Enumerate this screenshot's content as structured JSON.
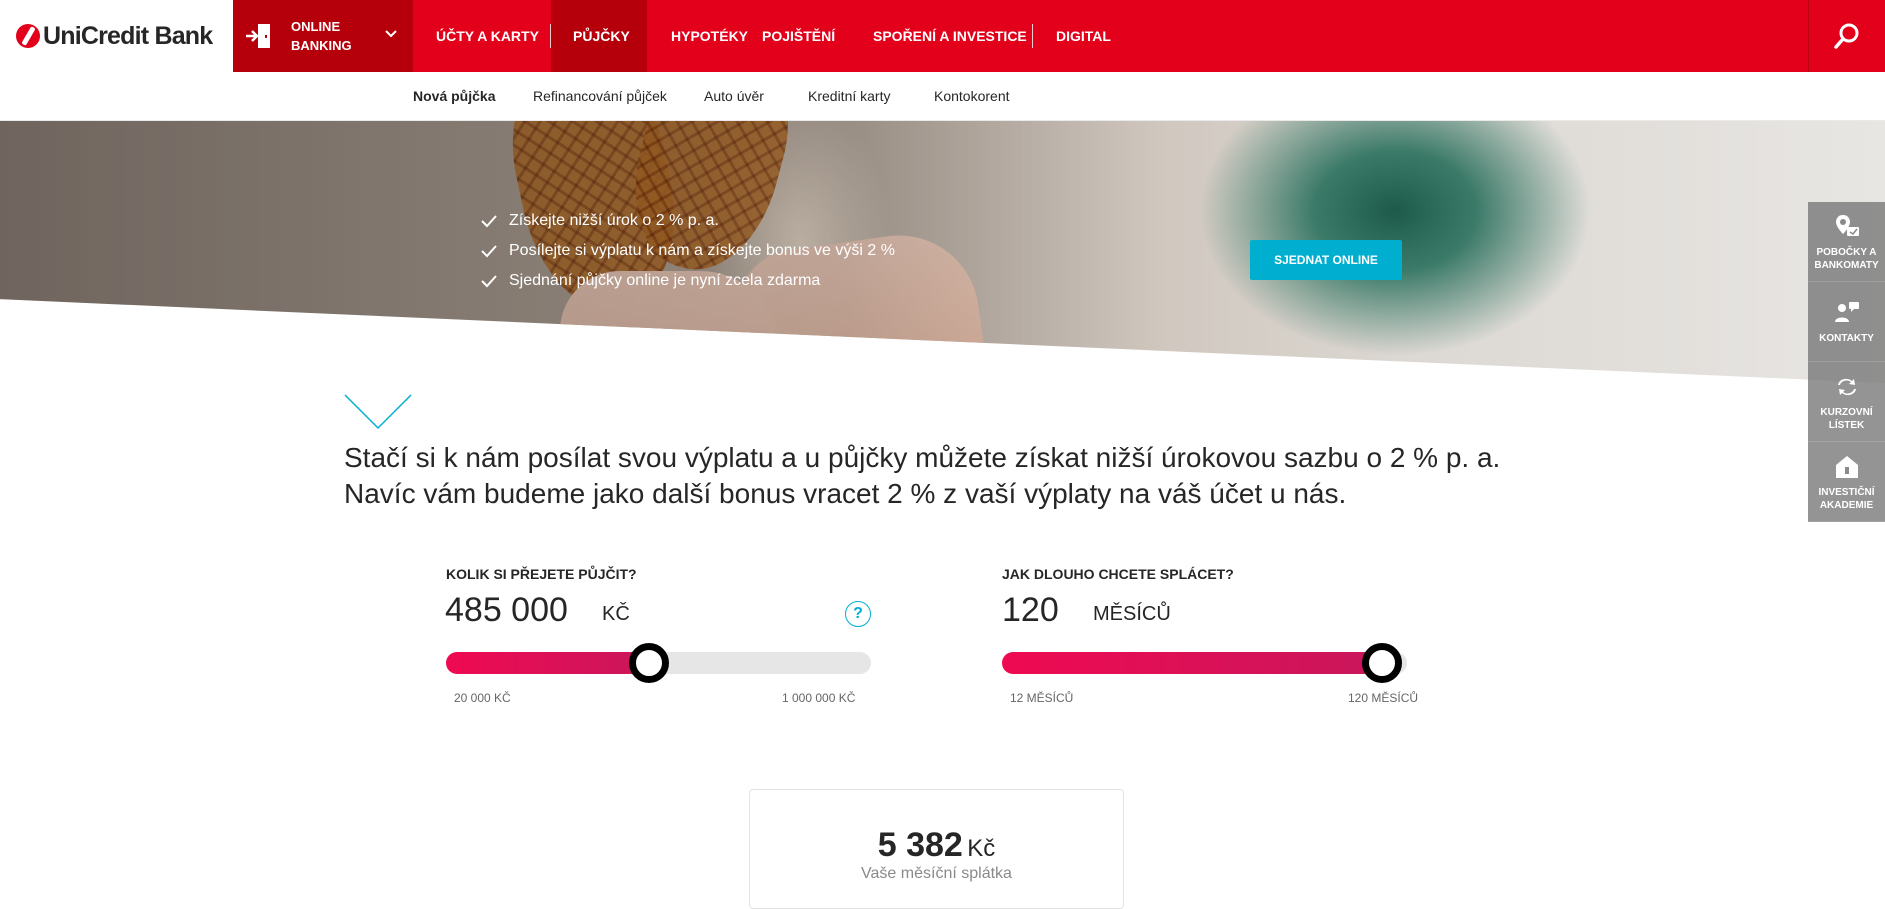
{
  "brand": {
    "name": "UniCredit Bank",
    "red": "#e2001a",
    "dark_red": "#b5000b",
    "accent": "#00afd0",
    "slider": "#ef0a52"
  },
  "online_banking": {
    "label": "ONLINE BANKING",
    "icon": "login-icon",
    "chevron": "chevron-down-icon"
  },
  "nav": {
    "items": [
      {
        "label": "ÚČTY A KARTY"
      },
      {
        "label": "PŮJČKY"
      },
      {
        "label": "HYPOTÉKY"
      },
      {
        "label": "POJIŠTĚNÍ"
      },
      {
        "label": "SPOŘENÍ A INVESTICE"
      },
      {
        "label": "DIGITAL"
      }
    ],
    "active": "PŮJČKY",
    "search_icon": "search-icon"
  },
  "subnav": {
    "items": [
      {
        "label": "Nová půjčka"
      },
      {
        "label": "Refinancování půjček"
      },
      {
        "label": "Auto úvěr"
      },
      {
        "label": "Kreditní karty"
      },
      {
        "label": "Kontokorent"
      }
    ],
    "active": "Nová půjčka"
  },
  "hero": {
    "benefits": [
      "Získejte nižší úrok o 2 % p. a.",
      "Posílejte si výplatu k nám a získejte bonus ve výši 2 %",
      "Sjednání půjčky online je nyní zcela zdarma"
    ],
    "cta": "SJEDNAT ONLINE"
  },
  "side_widget": {
    "items": [
      {
        "label": "POBOČKY A BANKOMATY",
        "icon": "branch-map-icon"
      },
      {
        "label": "KONTAKTY",
        "icon": "contact-icon"
      },
      {
        "label": "KURZOVNÍ LÍSTEK",
        "icon": "exchange-rate-icon"
      },
      {
        "label": "INVESTIČNÍ AKADEMIE",
        "icon": "academy-icon"
      }
    ]
  },
  "intro": {
    "line1": "Stačí si k nám posílat svou výplatu a u půjčky můžete získat nižší úrokovou sazbu o 2 % p. a.",
    "line2": "Navíc vám budeme jako další bonus vracet 2 % z vaší výplaty na váš účet u nás."
  },
  "calculator": {
    "amount": {
      "label": "KOLIK SI PŘEJETE PŮJČIT?",
      "value": "485 000",
      "unit": "KČ",
      "help": "?",
      "min_label": "20 000 KČ",
      "max_label": "1 000 000 KČ",
      "min": 20000,
      "max": 1000000,
      "current": 485000
    },
    "duration": {
      "label": "JAK DLOUHO CHCETE SPLÁCET?",
      "value": "120",
      "unit": "MĚSÍCŮ",
      "min_label": "12 MĚSÍCŮ",
      "max_label": "120 MĚSÍCŮ",
      "min": 12,
      "max": 120,
      "current": 120
    }
  },
  "result": {
    "amount": "5 382",
    "currency": "Kč",
    "caption": "Vaše měsíční splátka"
  }
}
